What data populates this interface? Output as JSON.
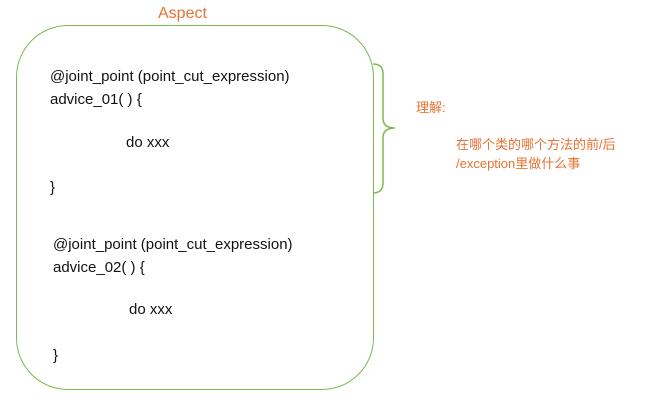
{
  "aspect_title": "Aspect",
  "blocks": [
    {
      "annotation": "@joint_point (point_cut_expression)",
      "signature": "advice_01( ) {",
      "body": "do xxx",
      "close": "}"
    },
    {
      "annotation": "@joint_point (point_cut_expression)",
      "signature": "advice_02( ) {",
      "body": "do xxx",
      "close": "}"
    }
  ],
  "explanation": {
    "label": "理解:",
    "line1": "在哪个类的哪个方法的前/后",
    "line2": "/exception里做什么事"
  },
  "colors": {
    "orange": "#e97132",
    "green": "#7dba4d"
  }
}
